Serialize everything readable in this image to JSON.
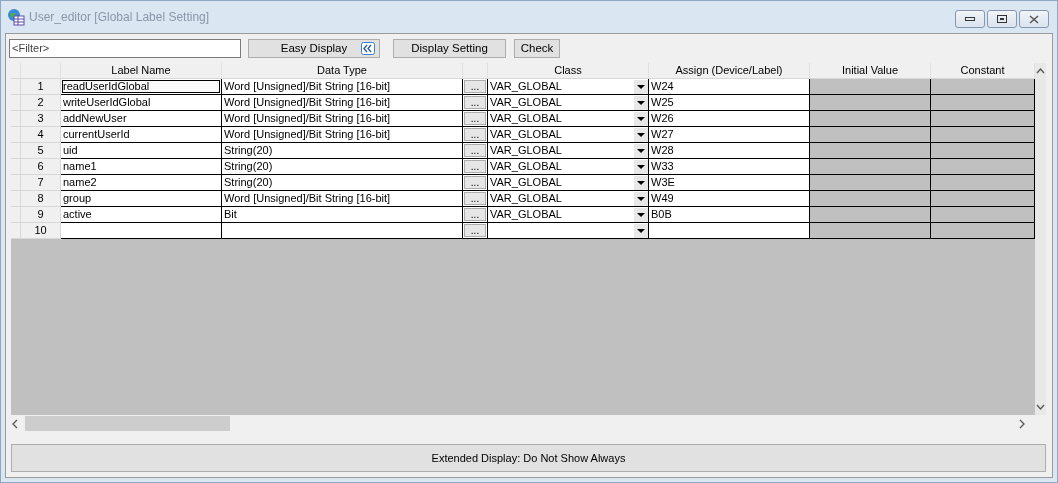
{
  "window": {
    "title": "User_editor [Global Label Setting]"
  },
  "toolbar": {
    "filter": {
      "placeholder": "<Filter>"
    },
    "buttons": [
      {
        "label": "Easy Display",
        "kind": "toggle"
      },
      {
        "label": "Display Setting",
        "kind": "plain"
      },
      {
        "label": "Check",
        "kind": "plain"
      }
    ]
  },
  "table": {
    "columns": [
      "Label Name",
      "Data Type",
      "Class",
      "Assign (Device/Label)",
      "Initial Value",
      "Constant"
    ],
    "rows": [
      {
        "number": "1",
        "label_name": "readUserIdGlobal",
        "data_type": "Word [Unsigned]/Bit String [16-bit]",
        "class": "VAR_GLOBAL",
        "assign": "W24",
        "browse": "...",
        "focused": true
      },
      {
        "number": "2",
        "label_name": "writeUserIdGlobal",
        "data_type": "Word [Unsigned]/Bit String [16-bit]",
        "class": "VAR_GLOBAL",
        "assign": "W25",
        "browse": "...",
        "focused": false
      },
      {
        "number": "3",
        "label_name": "addNewUser",
        "data_type": "Word [Unsigned]/Bit String [16-bit]",
        "class": "VAR_GLOBAL",
        "assign": "W26",
        "browse": "...",
        "focused": false
      },
      {
        "number": "4",
        "label_name": "currentUserId",
        "data_type": "Word [Unsigned]/Bit String [16-bit]",
        "class": "VAR_GLOBAL",
        "assign": "W27",
        "browse": "...",
        "focused": false
      },
      {
        "number": "5",
        "label_name": "uid",
        "data_type": "String(20)",
        "class": "VAR_GLOBAL",
        "assign": "W28",
        "browse": "...",
        "focused": false
      },
      {
        "number": "6",
        "label_name": "name1",
        "data_type": "String(20)",
        "class": "VAR_GLOBAL",
        "assign": "W33",
        "browse": "...",
        "focused": false
      },
      {
        "number": "7",
        "label_name": "name2",
        "data_type": "String(20)",
        "class": "VAR_GLOBAL",
        "assign": "W3E",
        "browse": "...",
        "focused": false
      },
      {
        "number": "8",
        "label_name": "group",
        "data_type": "Word [Unsigned]/Bit String [16-bit]",
        "class": "VAR_GLOBAL",
        "assign": "W49",
        "browse": "...",
        "focused": false
      },
      {
        "number": "9",
        "label_name": "active",
        "data_type": "Bit",
        "class": "VAR_GLOBAL",
        "assign": "B0B",
        "browse": "...",
        "focused": false
      },
      {
        "number": "10",
        "browse": "...",
        "focused": false
      }
    ]
  },
  "status_bar": {
    "label": "Extended Display: Do Not Show Always"
  }
}
